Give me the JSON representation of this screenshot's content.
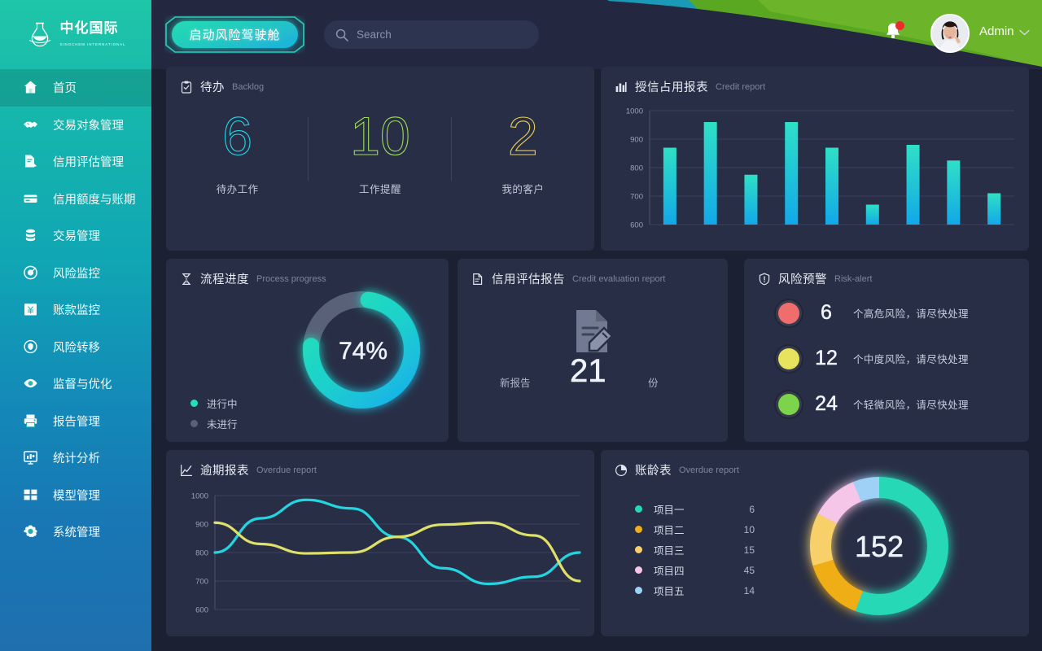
{
  "brand": {
    "name_cn": "中化国际",
    "name_en": "SINOCHEM INTERNATIONAL",
    "icon": "flask-icon"
  },
  "sidebar": {
    "items": [
      {
        "label": "首页",
        "icon": "home-icon",
        "active": true
      },
      {
        "label": "交易对象管理",
        "icon": "handshake-icon",
        "active": false
      },
      {
        "label": "信用评估管理",
        "icon": "document-edit-icon",
        "active": false
      },
      {
        "label": "信用额度与账期",
        "icon": "credit-card-icon",
        "active": false
      },
      {
        "label": "交易管理",
        "icon": "database-icon",
        "active": false
      },
      {
        "label": "风险监控",
        "icon": "target-icon",
        "active": false
      },
      {
        "label": "账款监控",
        "icon": "money-icon",
        "active": false
      },
      {
        "label": "风险转移",
        "icon": "shield-transfer-icon",
        "active": false
      },
      {
        "label": "监督与优化",
        "icon": "eye-icon",
        "active": false
      },
      {
        "label": "报告管理",
        "icon": "printer-icon",
        "active": false
      },
      {
        "label": "统计分析",
        "icon": "chart-board-icon",
        "active": false
      },
      {
        "label": "模型管理",
        "icon": "grid-icon",
        "active": false
      },
      {
        "label": "系统管理",
        "icon": "gear-icon",
        "active": false
      }
    ]
  },
  "header": {
    "launch_button": "启动风险驾驶舱",
    "search": {
      "placeholder": "Search",
      "value": "",
      "icon": "search-icon"
    },
    "bell": {
      "icon": "bell-icon",
      "has_badge": true
    },
    "user": {
      "name": "Admin",
      "avatar": "user-avatar",
      "caret": "chevron-down-icon"
    },
    "deco_colors": {
      "teal": "#1b9ab8",
      "green": "#5aa821",
      "green_light": "#6cb52a"
    }
  },
  "cards": {
    "backlog": {
      "title_cn": "待办",
      "title_en": "Backlog",
      "icon": "clipboard-check-icon",
      "stats": [
        {
          "value": "6",
          "label": "待办工作",
          "color": "#25d8e8"
        },
        {
          "value": "10",
          "label": "工作提醒",
          "color": "#9ddc5a"
        },
        {
          "value": "2",
          "label": "我的客户",
          "color": "#e8cf59"
        }
      ]
    },
    "credit_report": {
      "title_cn": "授信占用报表",
      "title_en": "Credit report",
      "icon": "bar-chart-icon"
    },
    "process_progress": {
      "title_cn": "流程进度",
      "title_en": "Process progress",
      "icon": "hourglass-icon",
      "percent_label": "74%",
      "legend": [
        {
          "label": "进行中",
          "color": "#1fe0b8"
        },
        {
          "label": "未进行",
          "color": "#596179"
        }
      ]
    },
    "credit_evaluation": {
      "title_cn": "信用评估报告",
      "title_en": "Credit evaluation report",
      "icon": "report-doc-icon",
      "left_label": "新报告",
      "count": "21",
      "unit": "份"
    },
    "risk_alert": {
      "title_cn": "风险预警",
      "title_en": "Risk-alert",
      "icon": "shield-alert-icon",
      "rows": [
        {
          "count": "6",
          "text": "个高危风险，请尽快处理",
          "color": "#f06d6d"
        },
        {
          "count": "12",
          "text": "个中度风险，请尽快处理",
          "color": "#e8e35e"
        },
        {
          "count": "24",
          "text": "个轻微风险，请尽快处理",
          "color": "#7cd44a"
        }
      ]
    },
    "overdue_report": {
      "title_cn": "逾期报表",
      "title_en": "Overdue report",
      "icon": "line-chart-icon"
    },
    "aging_report": {
      "title_cn": "账龄表",
      "title_en": "Overdue report",
      "icon": "pie-chart-icon",
      "total": "152"
    }
  },
  "chart_data": [
    {
      "id": "credit-report-bars",
      "type": "bar",
      "title": "授信占用报表",
      "subtitle": "Credit report",
      "categories": [
        "1",
        "2",
        "3",
        "4",
        "5",
        "6",
        "7",
        "8",
        "9"
      ],
      "values": [
        870,
        960,
        775,
        960,
        870,
        670,
        880,
        825,
        710
      ],
      "ylim": [
        600,
        1000
      ],
      "yticks": [
        600,
        700,
        800,
        900,
        1000
      ],
      "ylabel": "",
      "xlabel": "",
      "grid": true,
      "bar_color_top": "#2fe0c6",
      "bar_color_bottom": "#12a8e8",
      "legend": "none"
    },
    {
      "id": "process-progress-donut",
      "type": "pie",
      "title": "流程进度",
      "subtitle": "Process progress",
      "categories": [
        "进行中",
        "未进行"
      ],
      "values": [
        74,
        26
      ],
      "center_label": "74%",
      "colors": [
        "#1fe0b8",
        "#596179"
      ],
      "legend": "bottom-left"
    },
    {
      "id": "overdue-report-lines",
      "type": "line",
      "title": "逾期报表",
      "subtitle": "Overdue report",
      "x": [
        0,
        1,
        2,
        3,
        4,
        5,
        6,
        7,
        8
      ],
      "series": [
        {
          "name": "series-cyan",
          "color": "#23d5e0",
          "values": [
            800,
            920,
            985,
            955,
            855,
            745,
            690,
            715,
            800
          ]
        },
        {
          "name": "series-olive",
          "color": "#dfe06a",
          "values": [
            905,
            830,
            797,
            800,
            855,
            898,
            905,
            860,
            700
          ]
        }
      ],
      "ylim": [
        600,
        1000
      ],
      "yticks": [
        600,
        700,
        800,
        900,
        1000
      ],
      "grid": true,
      "legend": "none"
    },
    {
      "id": "aging-report-donut",
      "type": "pie",
      "title": "账龄表",
      "subtitle": "Overdue report",
      "center_label": "152",
      "categories": [
        "项目一",
        "项目二",
        "项目三",
        "项目四",
        "项目五"
      ],
      "values": [
        6,
        10,
        15,
        45,
        14
      ],
      "colors": [
        "#25d8b6",
        "#f0ae18",
        "#f8d06a",
        "#f6c6e8",
        "#9fd1f7"
      ],
      "legend": "left"
    }
  ]
}
